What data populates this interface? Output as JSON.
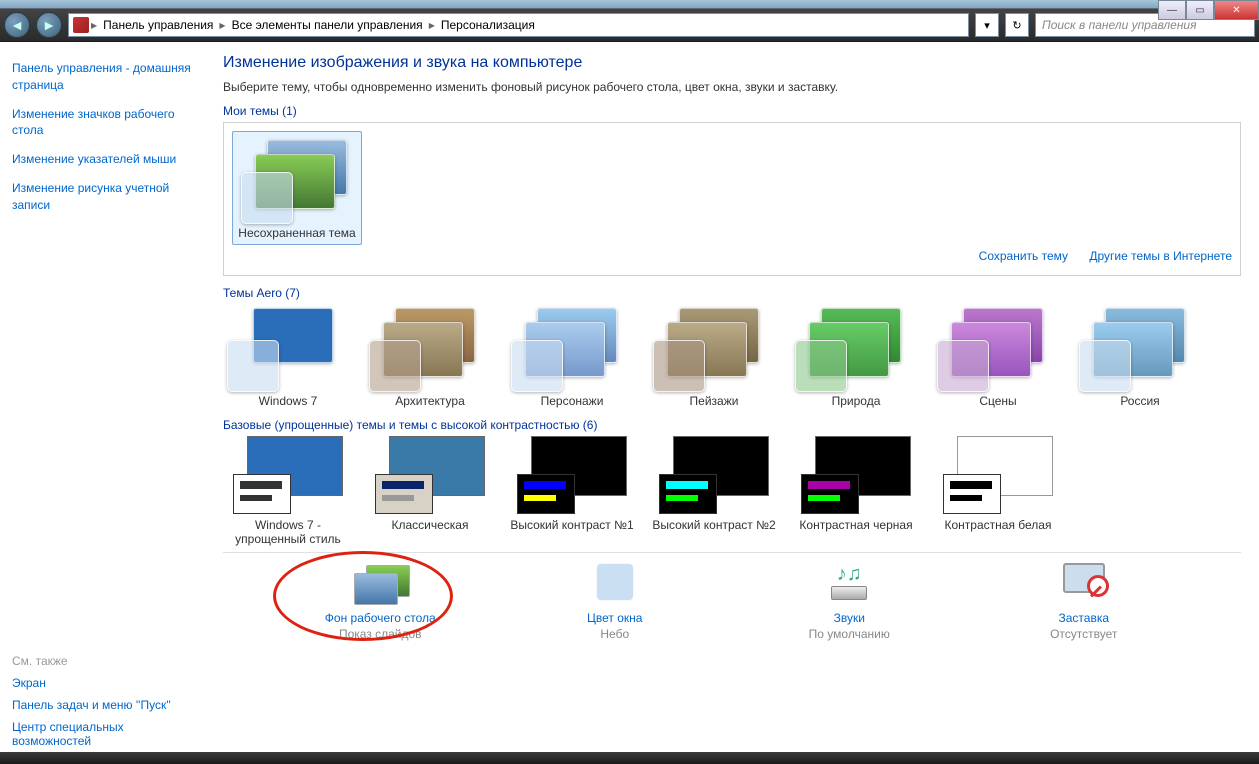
{
  "window_controls": {
    "minimize": "—",
    "maximize": "▭",
    "close": "✕"
  },
  "breadcrumb": {
    "segments": [
      "Панель управления",
      "Все элементы панели управления",
      "Персонализация"
    ]
  },
  "search_placeholder": "Поиск в панели управления",
  "sidebar": {
    "home": "Панель управления - домашняя страница",
    "links": [
      "Изменение значков рабочего стола",
      "Изменение указателей мыши",
      "Изменение рисунка учетной записи"
    ],
    "see_also_label": "См. также",
    "see_also": [
      "Экран",
      "Панель задач и меню ''Пуск''",
      "Центр специальных возможностей"
    ]
  },
  "page": {
    "title": "Изменение изображения и звука на компьютере",
    "desc": "Выберите тему, чтобы одновременно изменить фоновый рисунок рабочего стола, цвет окна, звуки и заставку."
  },
  "sections": {
    "my_themes": {
      "label": "Мои темы (1)",
      "items": [
        "Несохраненная тема"
      ]
    },
    "save_link": "Сохранить тему",
    "online_link": "Другие темы в Интернете",
    "aero": {
      "label": "Темы Aero (7)",
      "items": [
        "Windows 7",
        "Архитектура",
        "Персонажи",
        "Пейзажи",
        "Природа",
        "Сцены",
        "Россия"
      ]
    },
    "basic": {
      "label": "Базовые (упрощенные) темы и темы с высокой контрастностью (6)",
      "items": [
        "Windows 7 - упрощенный стиль",
        "Классическая",
        "Высокий контраст №1",
        "Высокий контраст №2",
        "Контрастная черная",
        "Контрастная белая"
      ]
    }
  },
  "footer": {
    "items": [
      {
        "label": "Фон рабочего стола",
        "sub": "Показ слайдов"
      },
      {
        "label": "Цвет окна",
        "sub": "Небо"
      },
      {
        "label": "Звуки",
        "sub": "По умолчанию"
      },
      {
        "label": "Заставка",
        "sub": "Отсутствует"
      }
    ]
  }
}
